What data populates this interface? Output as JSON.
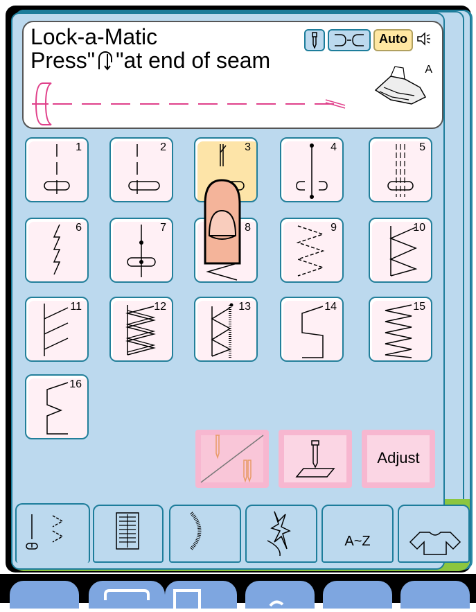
{
  "message": {
    "line1": "Lock-a-Matic",
    "line2_pre": "Press\"",
    "line2_post": "\"at end of seam",
    "foot": "A",
    "auto": "Auto"
  },
  "stitches": [
    {
      "num": "1",
      "selected": false
    },
    {
      "num": "2",
      "selected": false
    },
    {
      "num": "3",
      "selected": true
    },
    {
      "num": "4",
      "selected": false
    },
    {
      "num": "5",
      "selected": false
    },
    {
      "num": "6",
      "selected": false
    },
    {
      "num": "7",
      "selected": false
    },
    {
      "num": "8",
      "selected": false
    },
    {
      "num": "9",
      "selected": false
    },
    {
      "num": "10",
      "selected": false
    },
    {
      "num": "11",
      "selected": false
    },
    {
      "num": "12",
      "selected": false
    },
    {
      "num": "13",
      "selected": false
    },
    {
      "num": "14",
      "selected": false
    },
    {
      "num": "15",
      "selected": false
    },
    {
      "num": "16",
      "selected": false
    }
  ],
  "functions": {
    "adjust": "Adjust"
  },
  "tabs": {
    "az": "A~Z"
  }
}
